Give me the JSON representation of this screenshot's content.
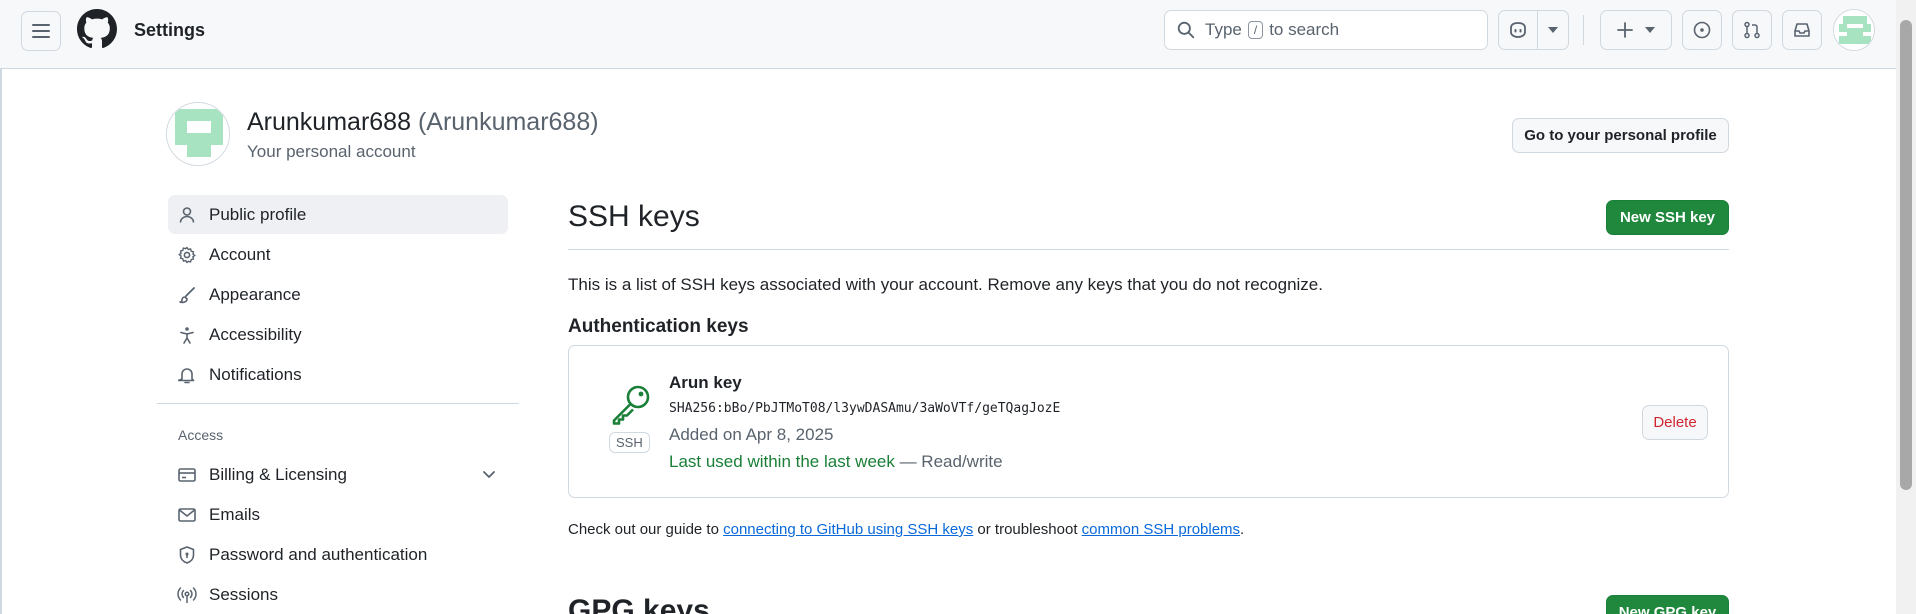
{
  "header": {
    "title": "Settings",
    "search_prefix": "Type",
    "search_key": "/",
    "search_suffix": "to search"
  },
  "profile": {
    "display_name": "Arunkumar688",
    "login": "(Arunkumar688)",
    "subtitle": "Your personal account",
    "profile_button": "Go to your personal profile"
  },
  "sidebar": {
    "items": [
      {
        "label": "Public profile"
      },
      {
        "label": "Account"
      },
      {
        "label": "Appearance"
      },
      {
        "label": "Accessibility"
      },
      {
        "label": "Notifications"
      }
    ],
    "access_heading": "Access",
    "access_items": [
      {
        "label": "Billing & Licensing"
      },
      {
        "label": "Emails"
      },
      {
        "label": "Password and authentication"
      },
      {
        "label": "Sessions"
      }
    ]
  },
  "main": {
    "ssh_title": "SSH keys",
    "new_ssh_button": "New SSH key",
    "description": "This is a list of SSH keys associated with your account. Remove any keys that you do not recognize.",
    "auth_heading": "Authentication keys",
    "key": {
      "type_label": "SSH",
      "title": "Arun key",
      "fingerprint": "SHA256:bBo/PbJTMoT08/l3ywDASAmu/3aWoVTf/geTQagJozE",
      "added": "Added on Apr 8, 2025",
      "last_used": "Last used within the last week",
      "access": " — Read/write",
      "delete_button": "Delete"
    },
    "guide": {
      "prefix": "Check out our guide to ",
      "link1": "connecting to GitHub using SSH keys",
      "middle": " or troubleshoot ",
      "link2": "common SSH problems",
      "suffix": "."
    },
    "gpg_title": "GPG keys",
    "new_gpg_button": "New GPG key"
  },
  "colors": {
    "primary_green": "#1f883d",
    "danger_red": "#d1242f",
    "link_blue": "#0969da",
    "success_green": "#1a7f37"
  },
  "icons": [
    "hamburger-icon",
    "github-logo-icon",
    "search-icon",
    "copilot-icon",
    "plus-icon",
    "issue-icon",
    "pull-request-icon",
    "inbox-icon",
    "person-icon",
    "gear-icon",
    "paintbrush-icon",
    "accessibility-icon",
    "bell-icon",
    "credit-card-icon",
    "mail-icon",
    "shield-icon",
    "broadcast-icon",
    "key-icon"
  ]
}
